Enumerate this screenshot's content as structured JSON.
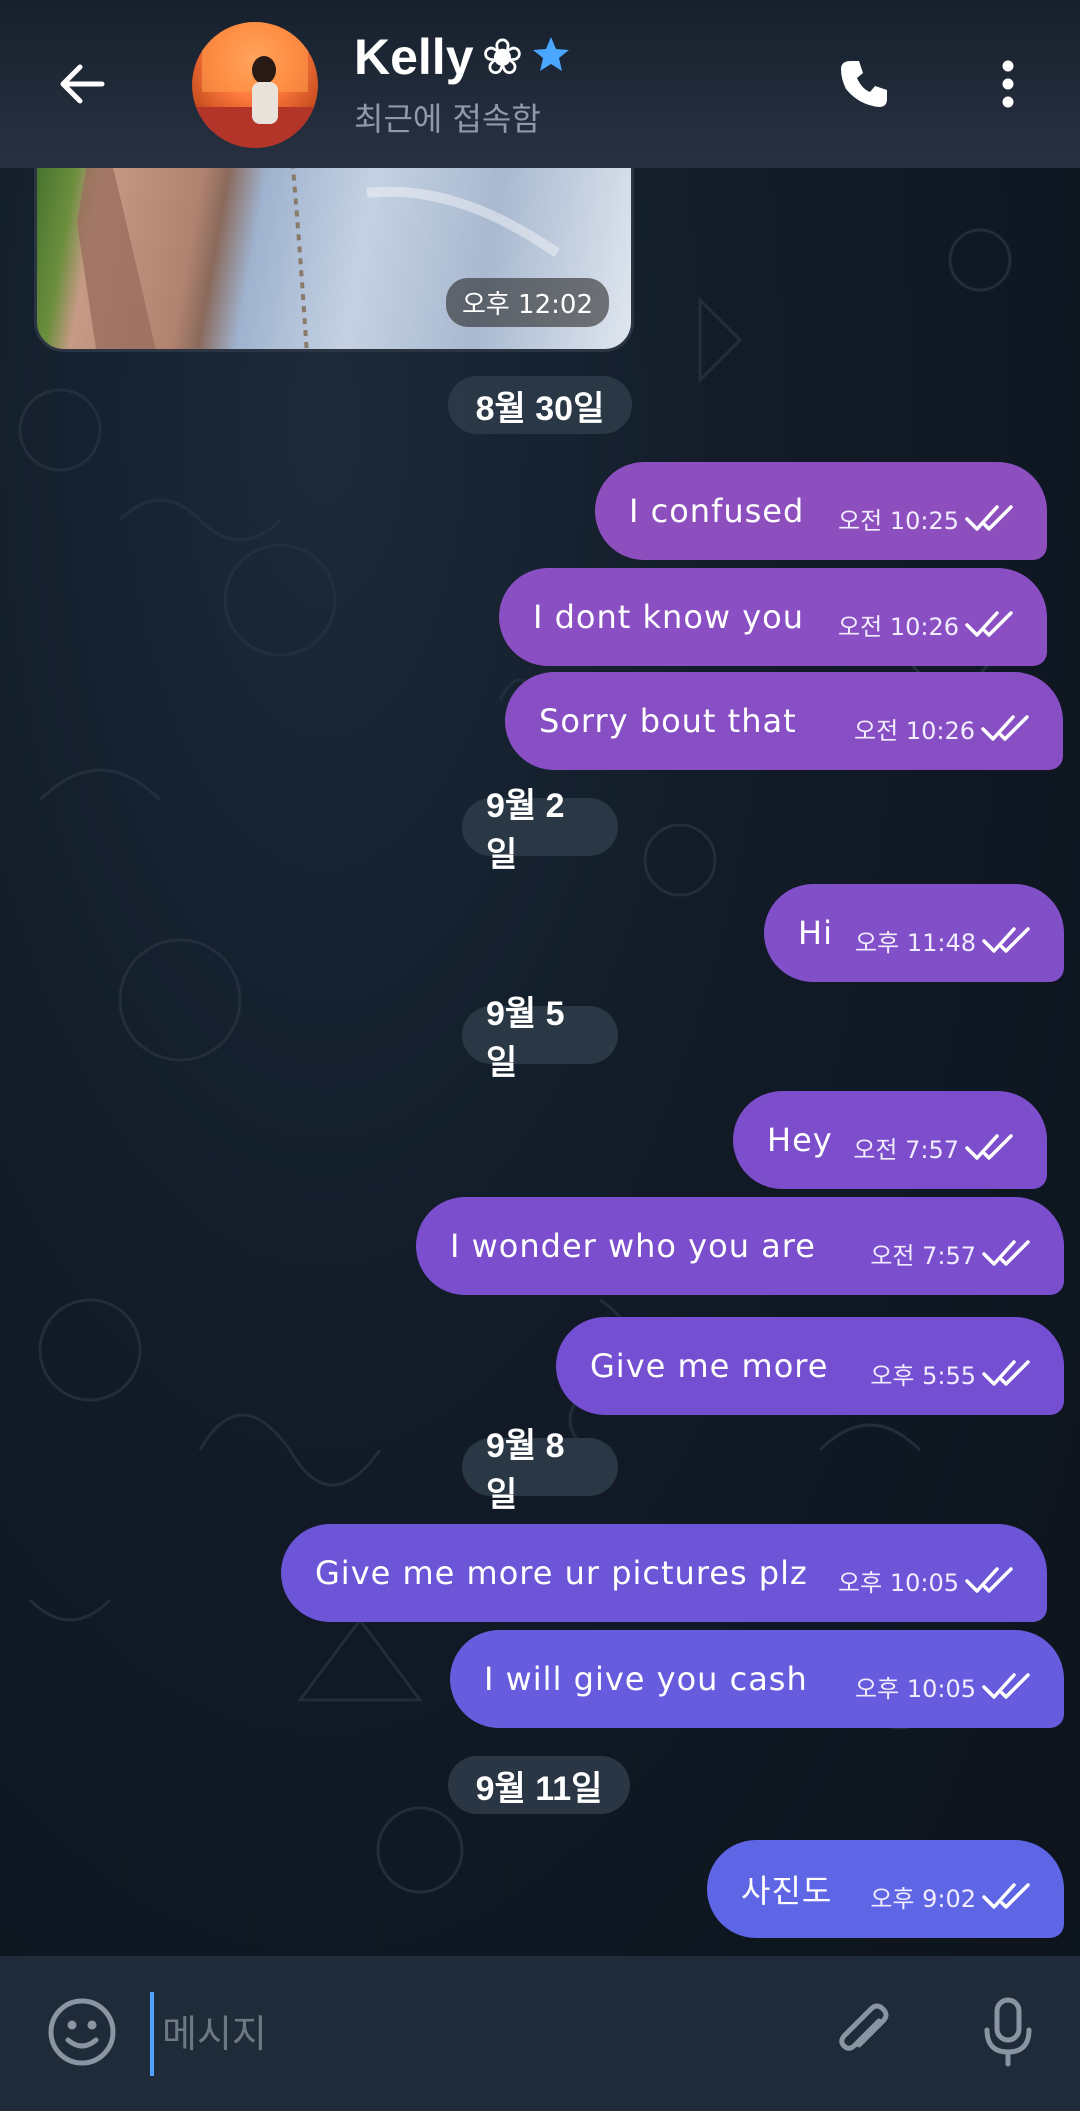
{
  "header": {
    "name": "Kelly",
    "name_flower": "❀",
    "status": "최근에 접속함"
  },
  "photo_message": {
    "time": "오후 12:02"
  },
  "dates": [
    "8월 30일",
    "9월 2일",
    "9월 5일",
    "9월 8일",
    "9월 11일"
  ],
  "messages": [
    {
      "text": "I confused",
      "time": "오전 10:25"
    },
    {
      "text": "I dont know you",
      "time": "오전 10:26"
    },
    {
      "text": "Sorry bout that",
      "time": "오전 10:26"
    },
    {
      "text": "Hi",
      "time": "오후 11:48"
    },
    {
      "text": "Hey",
      "time": "오전 7:57"
    },
    {
      "text": "I wonder who you are",
      "time": "오전 7:57"
    },
    {
      "text": "Give me more",
      "time": "오후 5:55"
    },
    {
      "text": "Give me more ur pictures plz",
      "time": "오후 10:05"
    },
    {
      "text": "I will give you cash",
      "time": "오후 10:05"
    },
    {
      "text": "사진도",
      "time": "오후 9:02"
    }
  ],
  "input": {
    "placeholder": "메시지"
  },
  "colors": {
    "bubble_top": "#8f4fbf",
    "bubble_mid": "#7b4cd0",
    "bubble_bottom": "#5d66e6",
    "accent": "#4da3ff"
  },
  "icons": {
    "back": "arrow-left-icon",
    "verified": "star-icon",
    "call": "phone-icon",
    "menu": "more-vertical-icon",
    "emoji": "smiley-icon",
    "attach": "paperclip-icon",
    "mic": "microphone-icon",
    "read": "double-check-icon"
  }
}
